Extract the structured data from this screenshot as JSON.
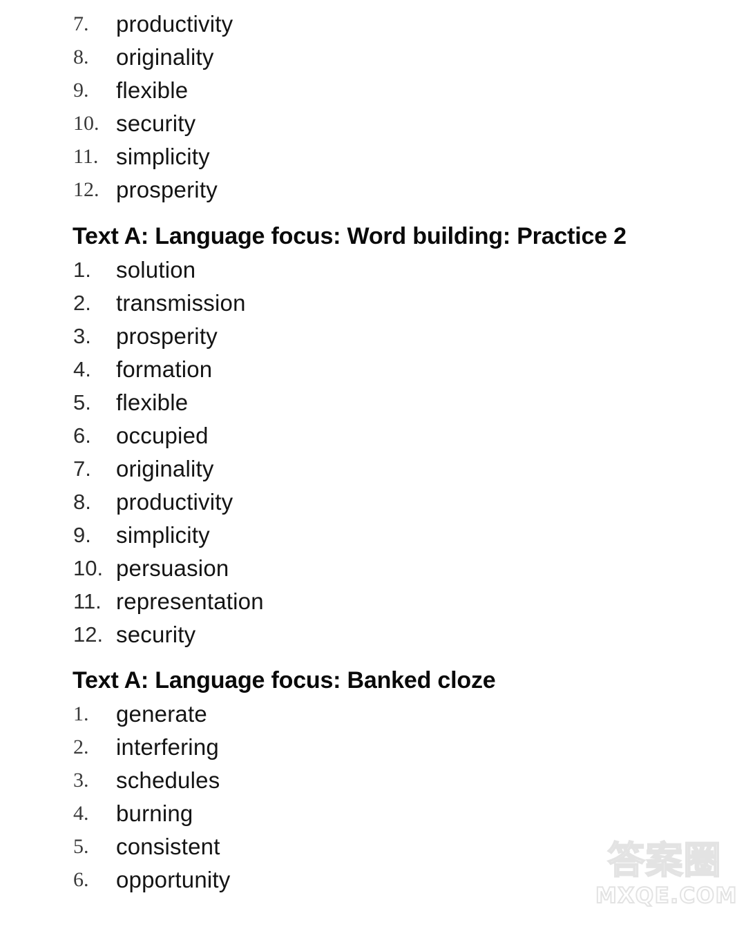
{
  "document": {
    "background_color": "#ffffff",
    "text_color": "#111111"
  },
  "sections": [
    {
      "id": "practice1",
      "heading": null,
      "number_style": "serif",
      "items": [
        {
          "number": "7.",
          "word": "productivity"
        },
        {
          "number": "8.",
          "word": "originality"
        },
        {
          "number": "9.",
          "word": "flexible"
        },
        {
          "number": "10.",
          "word": "security"
        },
        {
          "number": "11.",
          "word": "simplicity"
        },
        {
          "number": "12.",
          "word": "prosperity"
        }
      ]
    },
    {
      "id": "practice2",
      "heading": "Text A: Language focus: Word building: Practice 2",
      "number_style": "sans",
      "items": [
        {
          "number": "1.",
          "word": "solution"
        },
        {
          "number": "2.",
          "word": "transmission"
        },
        {
          "number": "3.",
          "word": "prosperity"
        },
        {
          "number": "4.",
          "word": "formation"
        },
        {
          "number": "5.",
          "word": "flexible"
        },
        {
          "number": "6.",
          "word": "occupied"
        },
        {
          "number": "7.",
          "word": "originality"
        },
        {
          "number": "8.",
          "word": "productivity"
        },
        {
          "number": "9.",
          "word": "simplicity"
        },
        {
          "number": "10.",
          "word": "persuasion"
        },
        {
          "number": "11.",
          "word": "representation"
        },
        {
          "number": "12.",
          "word": "security"
        }
      ]
    },
    {
      "id": "bankedcloze",
      "heading": "Text A: Language focus: Banked cloze",
      "number_style": "serif",
      "items": [
        {
          "number": "1.",
          "word": "generate"
        },
        {
          "number": "2.",
          "word": "interfering"
        },
        {
          "number": "3.",
          "word": "schedules"
        },
        {
          "number": "4.",
          "word": "burning"
        },
        {
          "number": "5.",
          "word": "consistent"
        },
        {
          "number": "6.",
          "word": "opportunity"
        }
      ]
    }
  ],
  "watermark": {
    "chinese": "答案圈",
    "url": "MXQE.COM",
    "color": "#e3e3e3"
  }
}
